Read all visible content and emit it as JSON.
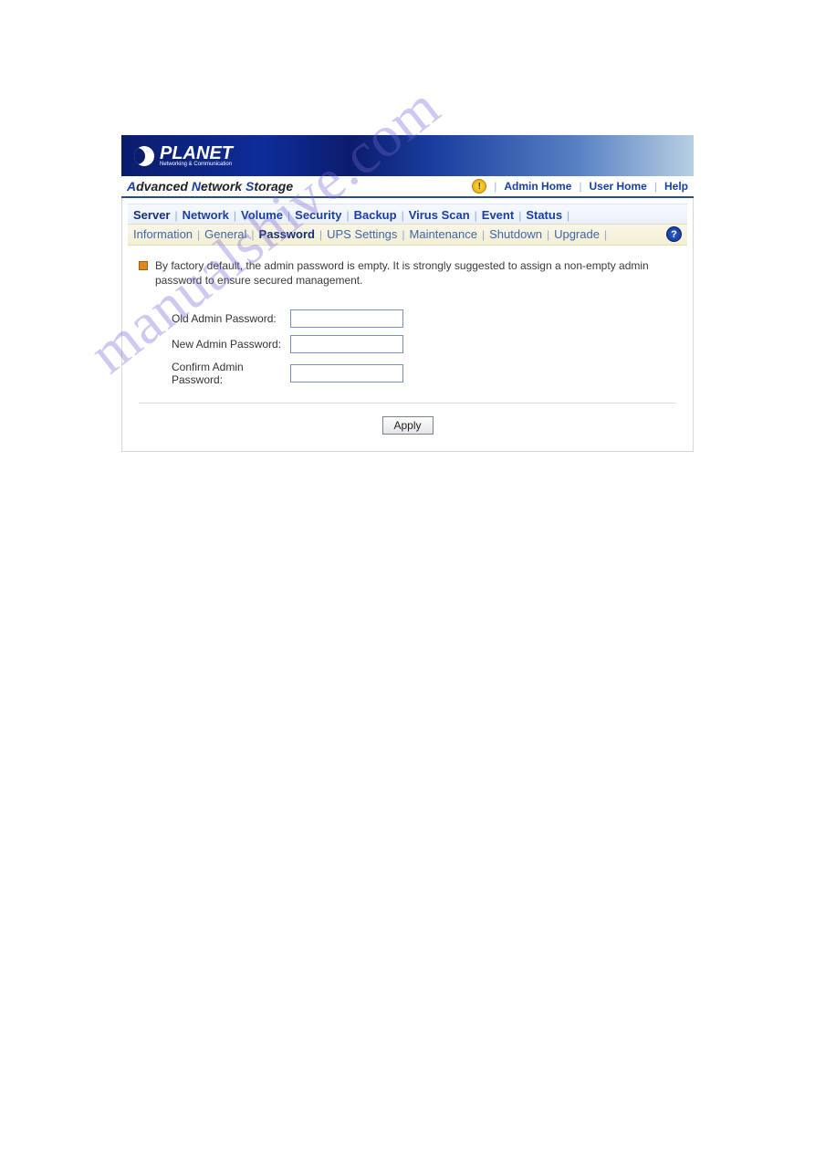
{
  "brand": "PLANET",
  "brand_tagline": "Networking & Communication",
  "product_title_parts": {
    "a": "A",
    "word1": "dvanced ",
    "n": "N",
    "word2": "etwork ",
    "s": "S",
    "word3": "torage"
  },
  "topnav": {
    "admin_home": "Admin Home",
    "user_home": "User Home",
    "help": "Help"
  },
  "tabs_primary": [
    "Server",
    "Network",
    "Volume",
    "Security",
    "Backup",
    "Virus Scan",
    "Event",
    "Status"
  ],
  "tabs_primary_active_index": 0,
  "tabs_sub": [
    "Information",
    "General",
    "Password",
    "UPS Settings",
    "Maintenance",
    "Shutdown",
    "Upgrade"
  ],
  "tabs_sub_active_index": 2,
  "note_text": "By factory default, the admin password is empty. It is strongly suggested to assign a non-empty admin password to ensure secured management.",
  "form": {
    "old_label": "Old Admin Password:",
    "new_label": "New Admin Password:",
    "confirm_label": "Confirm Admin Password:",
    "old_value": "",
    "new_value": "",
    "confirm_value": ""
  },
  "apply_label": "Apply",
  "watermark": "manualshive.com",
  "help_icon_glyph": "?",
  "warn_icon_glyph": "!"
}
